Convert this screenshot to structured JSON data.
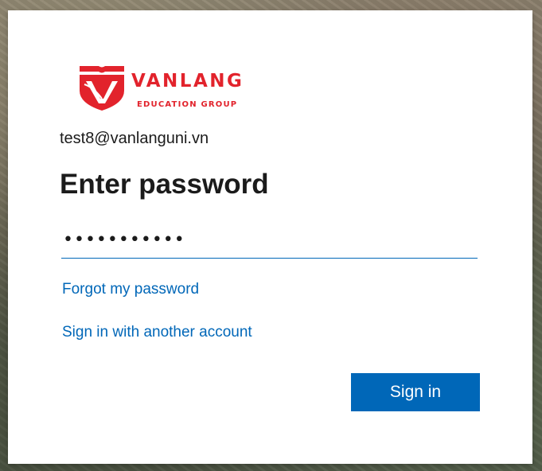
{
  "brand": {
    "logo_text": "VANLANG",
    "logo_subtext": "EDUCATION GROUP",
    "logo_icon": "vanlang-shield-logo",
    "color": "#e2232c"
  },
  "identity": {
    "email": "test8@vanlanguni.vn"
  },
  "page": {
    "title": "Enter password"
  },
  "password_field": {
    "value": "•••••••••••",
    "underline_color": "#0067b8"
  },
  "links": {
    "forgot": "Forgot my password",
    "other_account": "Sign in with another account",
    "color": "#0067b8"
  },
  "actions": {
    "sign_in": "Sign in",
    "button_color": "#0067b8"
  }
}
